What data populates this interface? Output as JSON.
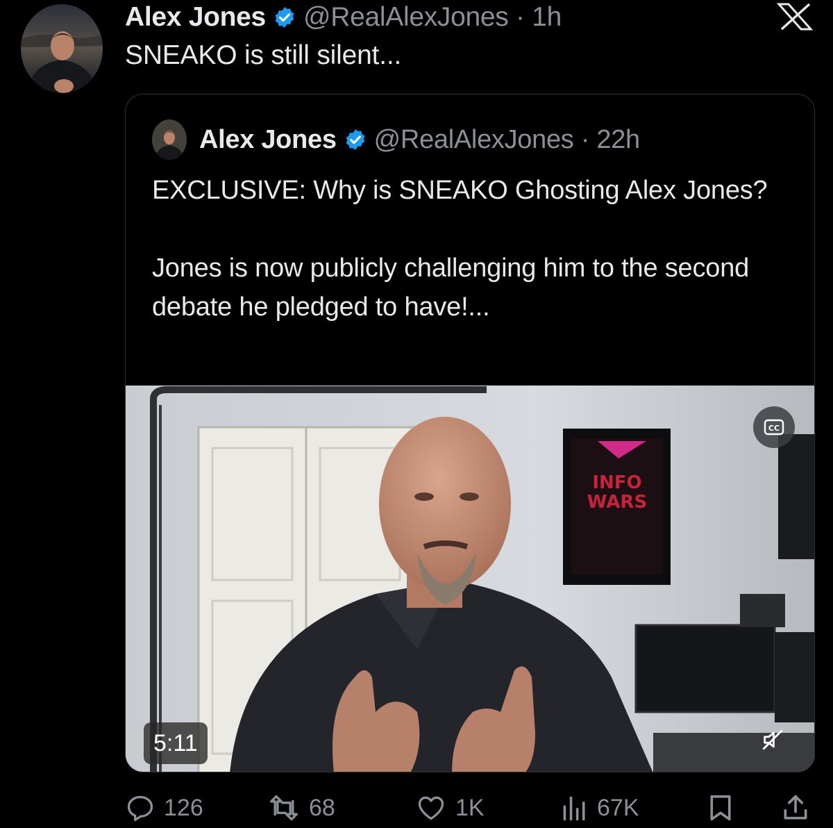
{
  "tweet": {
    "author_name": "Alex Jones",
    "handle": "@RealAlexJones · 1h",
    "text": "SNEAKO is still silent...",
    "avatar_icon": "user-avatar",
    "verified_icon": "verified-badge-icon"
  },
  "brand": {
    "logo": "x-logo-icon",
    "accent": "#1d9bf0"
  },
  "quoted_tweet": {
    "author_name": "Alex Jones",
    "handle": "@RealAlexJones · 22h",
    "text_lines": [
      "EXCLUSIVE: Why is SNEAKO Ghosting Alex Jones?",
      "Jones is now publicly challenging him to the second debate he pledged to have!..."
    ],
    "video": {
      "duration": "5:11",
      "cc_icon": "closed-captions-icon",
      "mute_icon": "muted-speaker-icon",
      "poster_text": [
        "INFO",
        "WARS"
      ]
    }
  },
  "actions": {
    "replies": {
      "icon": "reply-icon",
      "count": "126"
    },
    "reposts": {
      "icon": "repost-icon",
      "count": "68"
    },
    "likes": {
      "icon": "heart-icon",
      "count": "1K"
    },
    "views": {
      "icon": "views-icon",
      "count": "67K"
    },
    "bookmark": {
      "icon": "bookmark-icon"
    },
    "share": {
      "icon": "share-icon"
    }
  }
}
